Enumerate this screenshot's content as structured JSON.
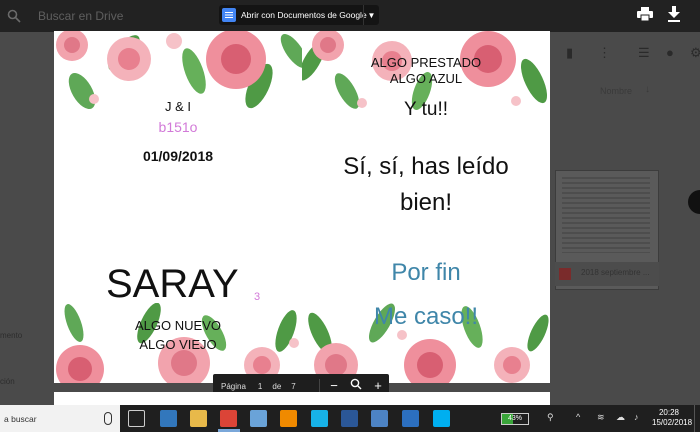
{
  "drive": {
    "search_placeholder": "Buscar en Drive",
    "column_name": "Nombre",
    "thumb_file_name": "2018 septiembre ...",
    "left_label_1": "mento",
    "left_label_2": "ción"
  },
  "viewer": {
    "open_with_label": "Abrir con Documentos de Google",
    "print_icon": "print-icon",
    "download_icon": "download-icon"
  },
  "document": {
    "left": {
      "initials": "J & I",
      "code": "b151o",
      "date": "01/09/2018",
      "name": "SARAY",
      "name_sub": "3",
      "line_algo_nuevo": "ALGO NUEVO",
      "line_algo_viejo": "ALGO VIEJO"
    },
    "right": {
      "line_algo_prestado": "ALGO PRESTADO",
      "line_algo_azul": "ALGO AZUL",
      "y_tu": "Y tu!!",
      "si_line1": "Sí, sí, has leído",
      "si_line2": "bien!",
      "por_fin": "Por fin",
      "me_caso": "Me caso!!"
    },
    "colors": {
      "pink": "#d27ad8",
      "teal": "#3f86a9",
      "rose": "#e87b8c",
      "leaf": "#4f9a45"
    }
  },
  "page_nav": {
    "label": "Página",
    "current": "1",
    "of_label": "de",
    "total": "7",
    "zoom_out": "−",
    "zoom_in": "+"
  },
  "taskbar": {
    "search_text": "a buscar",
    "battery_percent": "43%",
    "battery_level": 43,
    "time": "20:28",
    "date": "15/02/2018",
    "apps": [
      {
        "name": "task-view-icon",
        "color": "#1f1f1f"
      },
      {
        "name": "edge-icon",
        "color": "#3277bc"
      },
      {
        "name": "file-explorer-icon",
        "color": "#e8b94a"
      },
      {
        "name": "chrome-icon",
        "color": "#db4437"
      },
      {
        "name": "paint-icon",
        "color": "#6aa3d8"
      },
      {
        "name": "vlc-icon",
        "color": "#f08a00"
      },
      {
        "name": "kodi-icon",
        "color": "#17b2e7"
      },
      {
        "name": "word-icon",
        "color": "#2b5797"
      },
      {
        "name": "store-icon",
        "color": "#4d83c4"
      },
      {
        "name": "tuenti-icon",
        "color": "#2c6fbf"
      },
      {
        "name": "skype-icon",
        "color": "#00aff0"
      }
    ]
  }
}
